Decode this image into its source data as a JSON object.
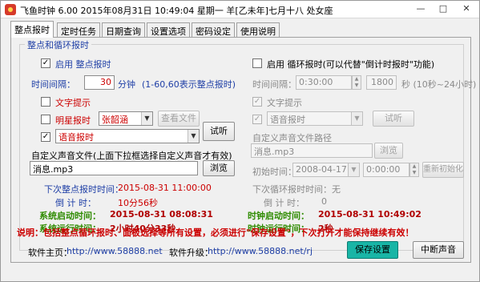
{
  "window": {
    "title": "飞鱼时钟 6.00 2015年08月31日 10:49:04 星期一 羊[乙未年]七月十八 处女座",
    "min": "—",
    "max": "□",
    "close": "✕"
  },
  "tabs": [
    "整点报时",
    "定时任务",
    "日期查询",
    "设置选项",
    "密码设定",
    "使用说明"
  ],
  "group_title": "整点和循环报时",
  "left": {
    "enable_label": "启用 整点报时",
    "interval_label": "时间间隔：",
    "interval_value": "30",
    "interval_unit": "分钟",
    "interval_hint": "(1-60,60表示整点报时)",
    "text_tip_label": "文字提示",
    "star_label": "明星报时",
    "star_value": "张韶涵",
    "view_file_button": "查看文件",
    "voice_value": "语音报时",
    "try_button": "试听",
    "custom_label": "自定义声音文件(上面下拉框选择自定义声音才有效)",
    "custom_file": "消息.mp3",
    "browse_button": "浏览",
    "next_label": "下次整点报时时间：",
    "next_value": "2015-08-31 11:00:00",
    "countdown_label": "倒 计 时：",
    "countdown_value": "10分56秒"
  },
  "right": {
    "enable_label": "启用 循环报时(可以代替\"倒计时报时\"功能)",
    "interval_label": "时间间隔：",
    "interval_time": "0:30:00",
    "interval_seconds": "1800",
    "interval_unit": "秒 (10秒~24小时)",
    "text_tip_label": "文字提示",
    "voice_value": "语音报时",
    "try_button": "试听",
    "custom_label": "自定义声音文件路径",
    "custom_file": "消息.mp3",
    "browse_button": "浏览",
    "init_label": "初始时间：",
    "init_date": "2008-04-17",
    "init_time": "0:00:00",
    "reinit_button": "重新初始化",
    "next_label": "下次循环报时时间：无",
    "countdown_label": "倒 计 时：",
    "countdown_value": "0"
  },
  "stats": {
    "sys_start_label": "系统启动时间：",
    "sys_start_value": "2015-08-31 08:08:31",
    "sys_run_label": "系统运行时间：",
    "sys_run_value": "2小时40分33秒",
    "clock_start_label": "时钟启动时间：",
    "clock_start_value": "2015-08-31 10:49:02",
    "clock_run_label": "时钟运行时间：",
    "clock_run_value": "2秒"
  },
  "notice": "说明：包括整点循环报时、面板选择等所有设置，必须进行\"保存设置\"，下次打开才能保持继续有效！",
  "footer": {
    "home_label": "软件主页：",
    "home_url": "http://www.58888.net",
    "upgrade_label": "软件升级：",
    "upgrade_url": "http://www.58888.net/rj",
    "save_button": "保存设置",
    "stop_button": "中断声音"
  }
}
